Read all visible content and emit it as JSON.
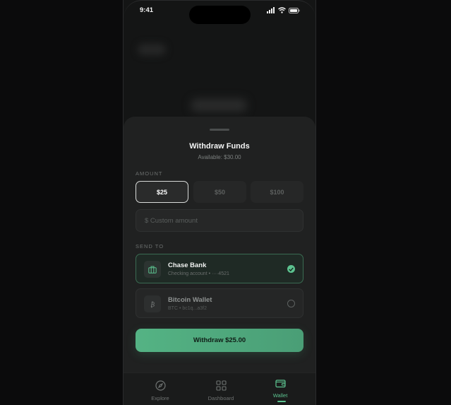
{
  "status_bar": {
    "time": "9:41"
  },
  "sheet": {
    "title": "Withdraw Funds",
    "available": "Available: $30.00",
    "amount_label": "AMOUNT",
    "amounts": [
      {
        "label": "$25",
        "selected": true
      },
      {
        "label": "$50",
        "selected": false
      },
      {
        "label": "$100",
        "selected": false
      }
    ],
    "custom_amount_placeholder": "$ Custom amount",
    "send_to_label": "SEND TO",
    "destinations": [
      {
        "title": "Chase Bank",
        "subtitle": "Checking account • ····4521",
        "selected": true,
        "icon": "bank-icon"
      },
      {
        "title": "Bitcoin Wallet",
        "subtitle": "BTC • bc1q...a3f2",
        "selected": false,
        "icon": "bitcoin-icon"
      }
    ],
    "withdraw_button": "Withdraw $25.00"
  },
  "tabs": [
    {
      "label": "Explore",
      "icon": "compass-icon",
      "active": false
    },
    {
      "label": "Dashboard",
      "icon": "grid-icon",
      "active": false
    },
    {
      "label": "Wallet",
      "icon": "wallet-icon",
      "active": true
    }
  ],
  "colors": {
    "accent": "#5cc28f",
    "background": "#0b0b0c",
    "sheet": "#202121"
  }
}
